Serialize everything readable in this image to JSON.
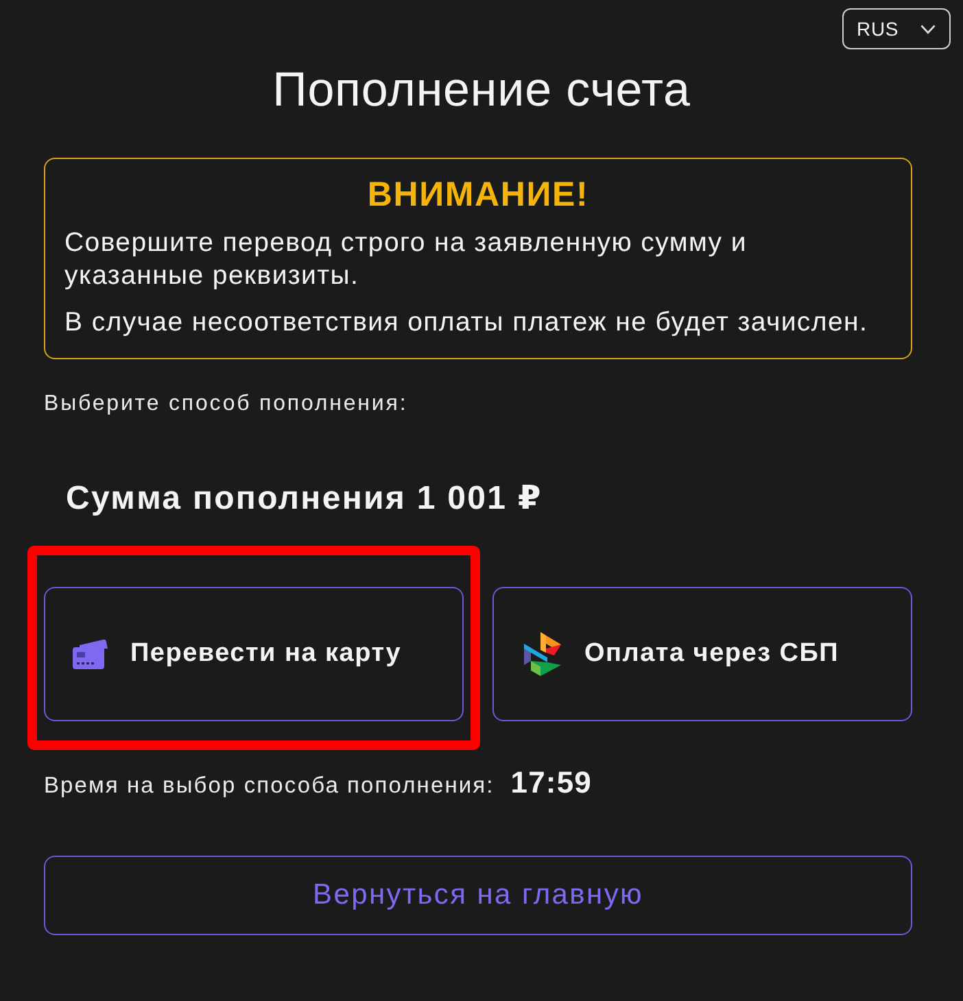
{
  "language_select": {
    "value": "RUS"
  },
  "title": "Пополнение счета",
  "warning": {
    "heading": "ВНИМАНИЕ!",
    "paragraphs": [
      "Совершите перевод строго на заявленную сумму и указанные реквизиты.",
      "В случае несоответствия оплаты платеж не будет зачислен."
    ]
  },
  "method_prompt": "Выберите способ пополнения:",
  "amount": "Сумма пополнения 1 001 ₽",
  "methods": [
    {
      "kind": "card",
      "label": "Перевести на карту",
      "highlighted": true
    },
    {
      "kind": "sbp",
      "label": "Оплата через СБП",
      "highlighted": false
    }
  ],
  "timer": {
    "label": "Время на выбор способа пополнения:",
    "value": "17:59"
  },
  "back_button": "Вернуться на главную"
}
